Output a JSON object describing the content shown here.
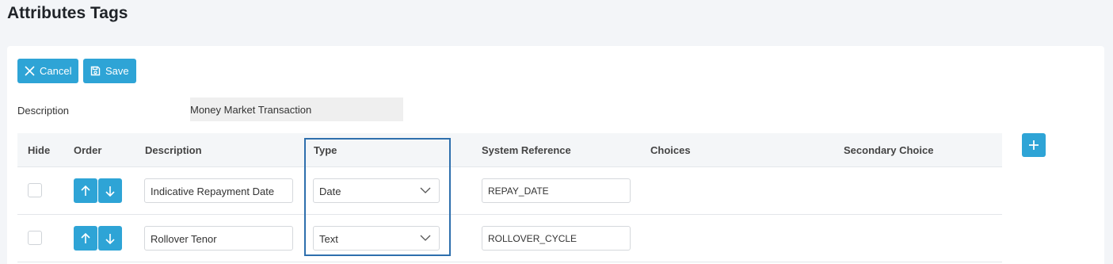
{
  "page": {
    "title": "Attributes Tags"
  },
  "toolbar": {
    "cancel_label": "Cancel",
    "save_label": "Save"
  },
  "form": {
    "description_label": "Description",
    "description_value": "Money Market Transaction"
  },
  "table": {
    "headers": {
      "hide": "Hide",
      "order": "Order",
      "description": "Description",
      "type": "Type",
      "system_reference": "System Reference",
      "choices": "Choices",
      "secondary_choice": "Secondary Choice"
    },
    "rows": [
      {
        "hide": false,
        "description": "Indicative Repayment Date",
        "type": "Date",
        "system_reference": "REPAY_DATE"
      },
      {
        "hide": false,
        "description": "Rollover Tenor",
        "type": "Text",
        "system_reference": "ROLLOVER_CYCLE"
      }
    ]
  },
  "icons": {
    "cancel": "close-icon",
    "save": "save-icon",
    "up": "arrow-up-icon",
    "down": "arrow-down-icon",
    "dropdown": "chevron-down-icon",
    "add": "plus-icon"
  },
  "colors": {
    "primary": "#2ea4d6",
    "highlight_border": "#2e6fad",
    "background": "#f3f5f8"
  }
}
